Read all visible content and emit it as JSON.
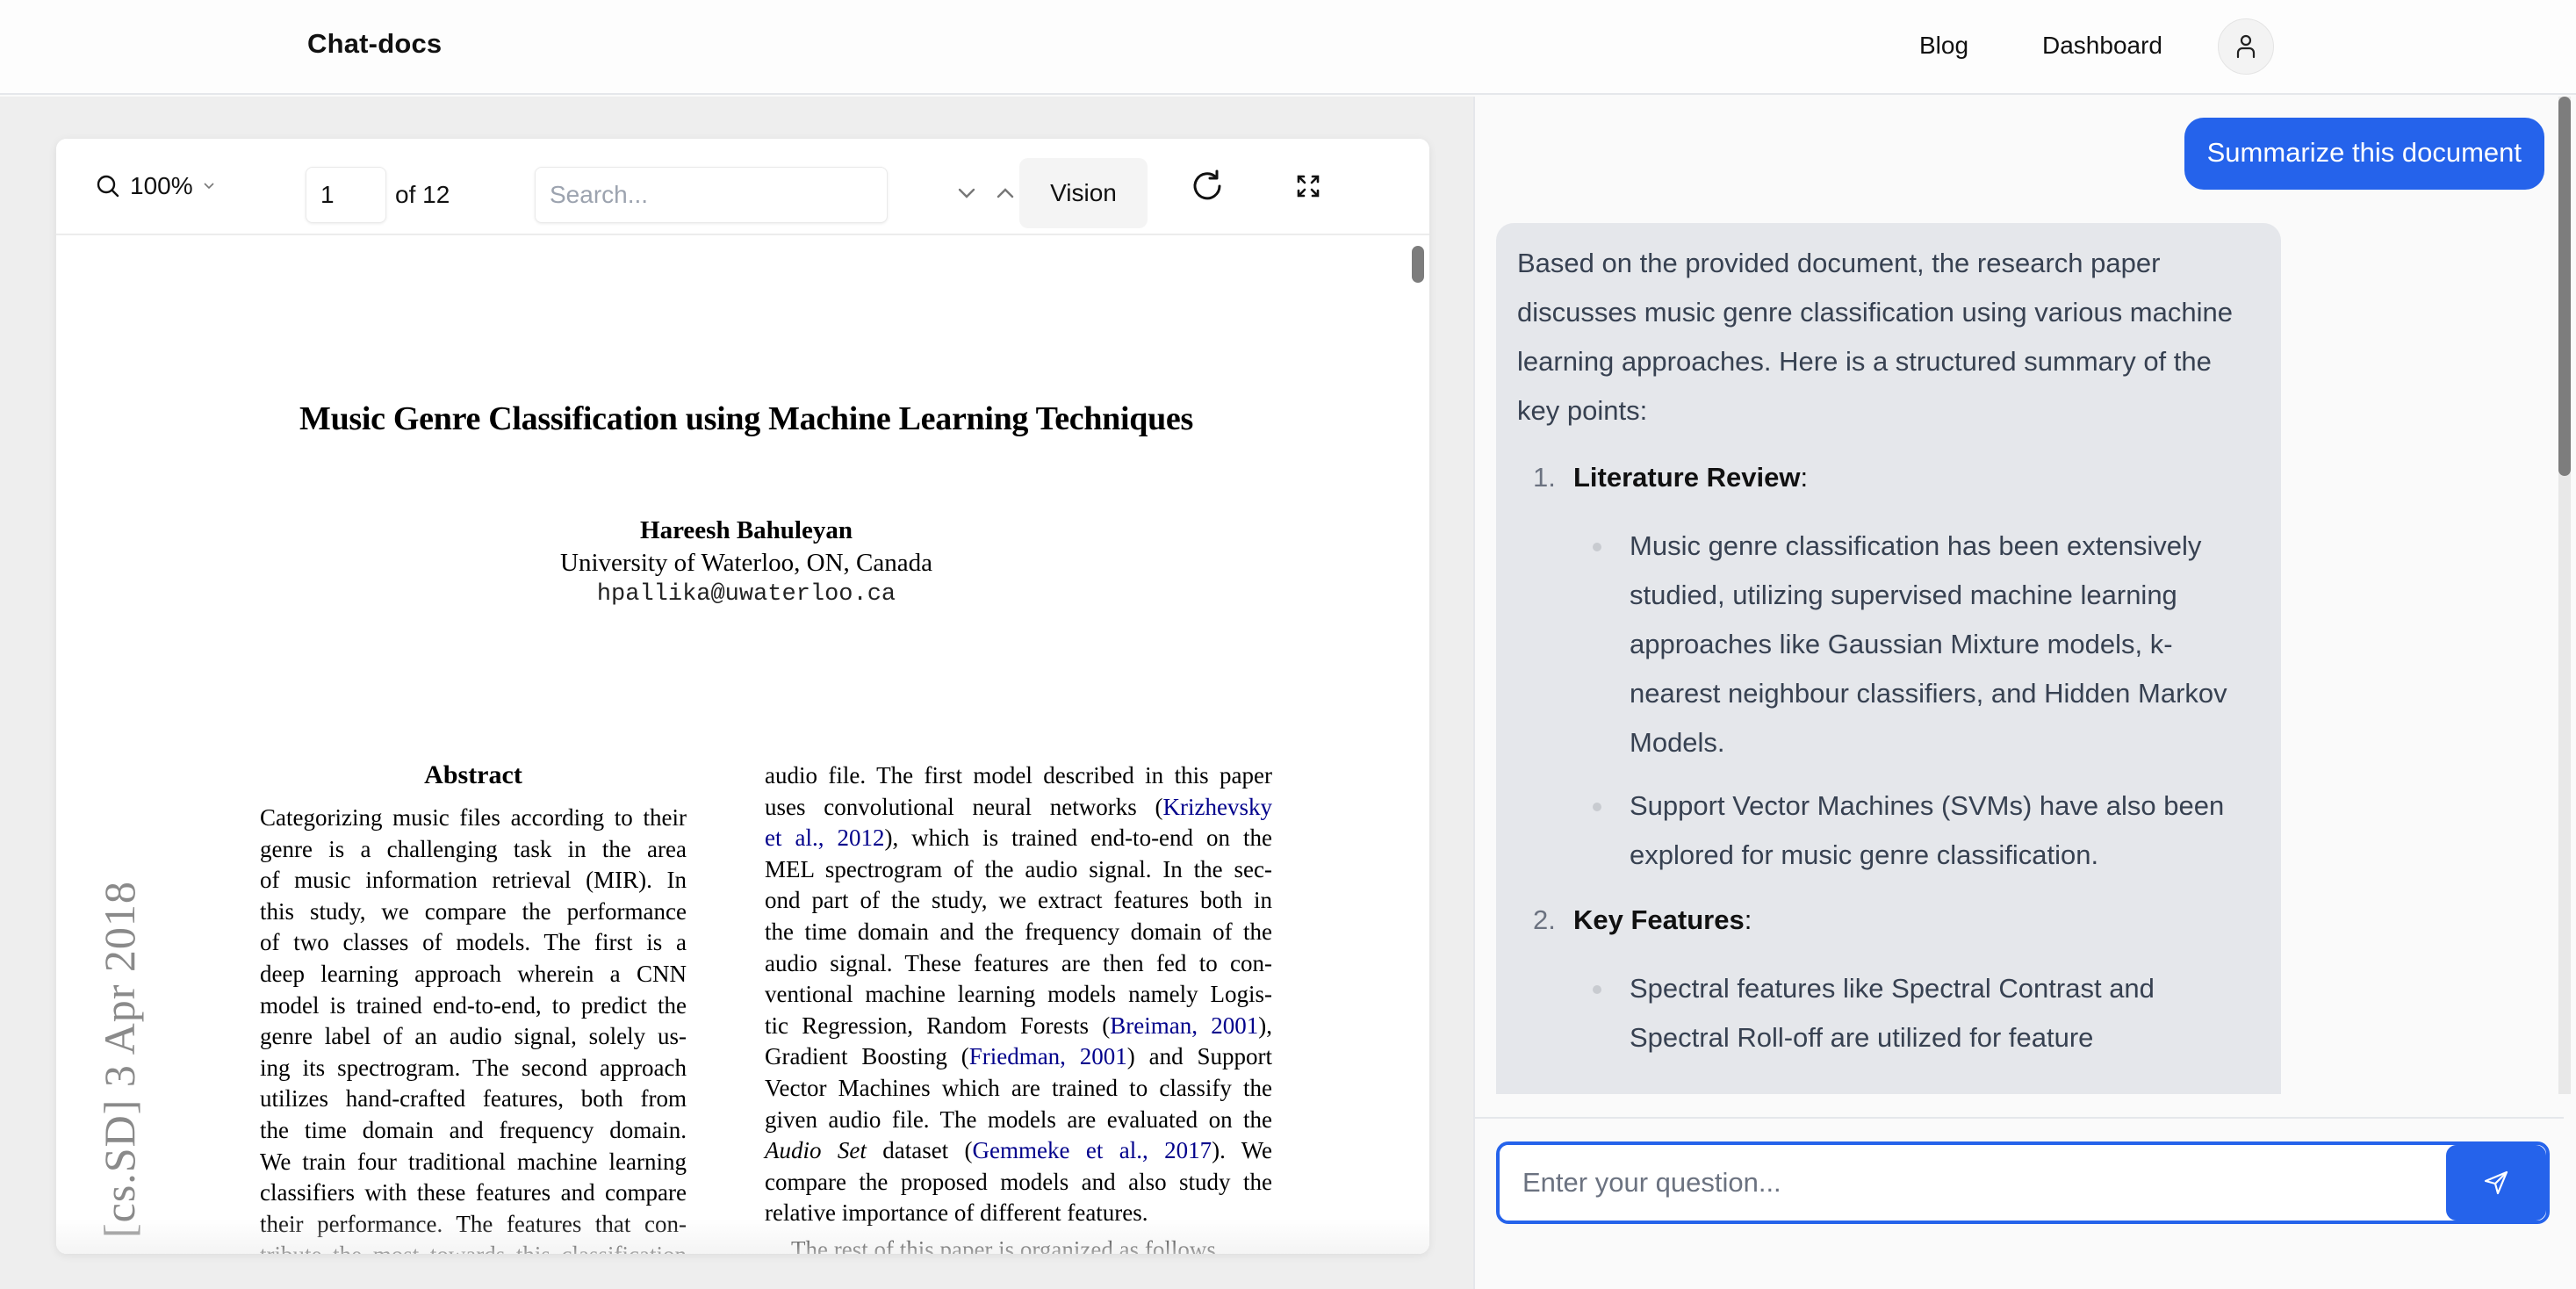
{
  "header": {
    "brand": "Chat-docs",
    "nav": [
      "Blog",
      "Dashboard"
    ],
    "avatar_icon": "user-icon"
  },
  "viewer": {
    "zoom": "100%",
    "page_current": "1",
    "page_total_label": "of 12",
    "search_placeholder": "Search...",
    "vision_label": "Vision",
    "icons": {
      "zoom": "magnifier-icon",
      "zoom_menu": "chevron-down-icon",
      "next_match": "chevron-down-icon",
      "prev_match": "chevron-up-icon",
      "rotate": "rotate-icon",
      "fullscreen": "expand-icon"
    }
  },
  "document": {
    "title": "Music Genre Classification using Machine Learning Techniques",
    "author": "Hareesh Bahuleyan",
    "affiliation": "University of Waterloo, ON, Canada",
    "email": "hpallika@uwaterloo.ca",
    "arxiv_stamp": "[cs.SD]  3 Apr 2018",
    "abstract_heading": "Abstract",
    "left_column_lines": [
      "Categorizing music files according to their",
      "genre is a challenging task in the area",
      "of music information retrieval (MIR). In",
      "this study, we compare the performance",
      "of two classes of models.  The first is a",
      "deep learning approach wherein a CNN",
      "model is trained end-to-end, to predict the",
      "genre label of an audio signal, solely us-",
      "ing its spectrogram. The second approach",
      "utilizes hand-crafted features, both from",
      "the time domain and frequency domain.",
      "We train four traditional machine learning",
      "classifiers with these features and compare",
      "their performance.  The features that con-",
      "tribute the most towards this classification"
    ],
    "right_column_lines": [
      [
        {
          "t": "audio file.  The first model described in this paper"
        }
      ],
      [
        {
          "t": "uses convolutional neural networks ("
        },
        {
          "t": "Krizhevsky",
          "cite": true
        }
      ],
      [
        {
          "t": "et al., 2012",
          "cite": true
        },
        {
          "t": "), which is trained end-to-end on the"
        }
      ],
      [
        {
          "t": "MEL spectrogram of the audio signal.  In the sec-"
        }
      ],
      [
        {
          "t": "ond part of the study, we extract features both in"
        }
      ],
      [
        {
          "t": "the time domain and the frequency domain of the"
        }
      ],
      [
        {
          "t": "audio signal.  These features are then fed to con-"
        }
      ],
      [
        {
          "t": "ventional machine learning models namely Logis-"
        }
      ],
      [
        {
          "t": "tic Regression, Random Forests ("
        },
        {
          "t": "Breiman, 2001",
          "cite": true
        },
        {
          "t": "),"
        }
      ],
      [
        {
          "t": "Gradient Boosting ("
        },
        {
          "t": "Friedman, 2001",
          "cite": true
        },
        {
          "t": ") and Support"
        }
      ],
      [
        {
          "t": "Vector Machines which are trained to classify the"
        }
      ],
      [
        {
          "t": "given audio file.  The models are evaluated on the"
        }
      ],
      [
        {
          "t": "Audio Set",
          "ital": true
        },
        {
          "t": " dataset ("
        },
        {
          "t": "Gemmeke et al., 2017",
          "cite": true
        },
        {
          "t": ").   We"
        }
      ],
      [
        {
          "t": "compare the proposed models and also study the"
        }
      ],
      [
        {
          "t": "relative importance of different features.",
          "last": true
        }
      ],
      [
        {
          "t": "    The rest of this paper is organized as follows."
        }
      ]
    ]
  },
  "chat": {
    "messages": [
      {
        "role": "user",
        "text": "Summarize this document"
      },
      {
        "role": "assistant",
        "intro": "Based on the provided document, the research paper discusses music genre classification using various machine learning approaches. Here is a structured summary of the key points:",
        "sections": [
          {
            "number": "1.",
            "heading": "Literature Review",
            "bullets": [
              "Music genre classification has been extensively studied, utilizing supervised machine learning approaches like Gaussian Mixture models, k-nearest neighbour classifiers, and Hidden Markov Models.",
              "Support Vector Machines (SVMs) have also been explored for music genre classification."
            ]
          },
          {
            "number": "2.",
            "heading": "Key Features",
            "bullets": [
              "Spectral features like Spectral Contrast and Spectral Roll-off are utilized for feature"
            ]
          }
        ]
      }
    ],
    "input_placeholder": "Enter your question...",
    "send_icon": "send-icon"
  },
  "colors": {
    "accent": "#2563eb",
    "assistant_bubble": "#e5e7eb",
    "citation": "#00008b"
  }
}
